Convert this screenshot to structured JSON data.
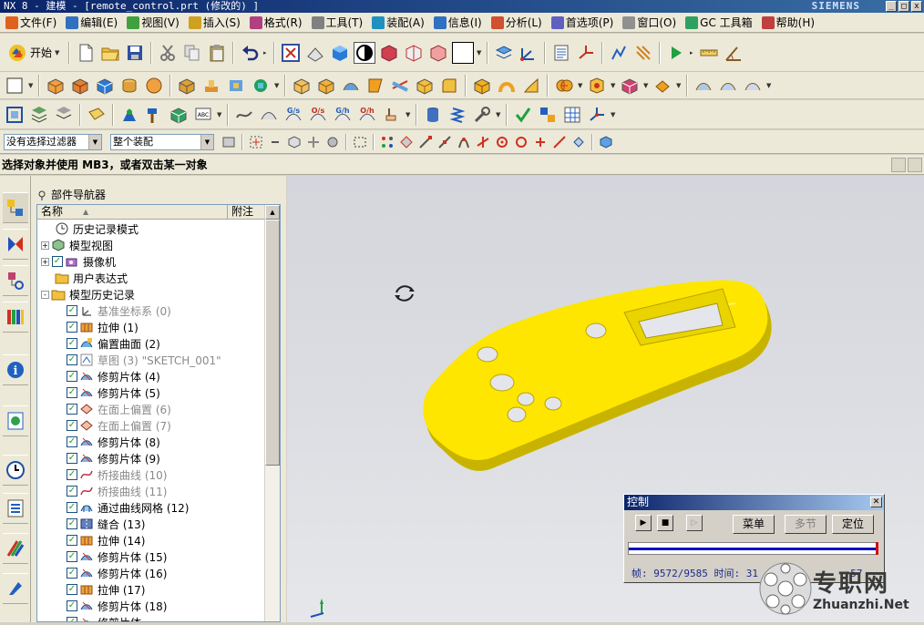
{
  "window": {
    "title": "NX 8 - 建模 - [remote_control.prt (修改的) ]",
    "brand": "SIEMENS",
    "controls": [
      "_",
      "□",
      "x"
    ]
  },
  "menu": {
    "items": [
      "文件(F)",
      "编辑(E)",
      "视图(V)",
      "插入(S)",
      "格式(R)",
      "工具(T)",
      "装配(A)",
      "信息(I)",
      "分析(L)",
      "首选项(P)",
      "窗口(O)",
      "GC 工具箱",
      "帮助(H)"
    ]
  },
  "toolbar": {
    "start_label": "开始"
  },
  "selection": {
    "filter_value": "没有选择过滤器",
    "scope_value": "整个装配"
  },
  "status": {
    "prompt": "选择对象并使用 MB3，或者双击某一对象"
  },
  "navigator": {
    "title": "部件导航器",
    "col_name": "名称",
    "col_attach": "附注",
    "nodes": [
      {
        "label": "历史记录模式",
        "icon": "clock-icon",
        "check": false,
        "dim": false,
        "expander": "",
        "indent": 1
      },
      {
        "label": "模型视图",
        "icon": "model-view-icon",
        "check": false,
        "dim": false,
        "expander": "+",
        "indent": 0
      },
      {
        "label": "摄像机",
        "icon": "camera-icon",
        "check": true,
        "dim": false,
        "expander": "+",
        "indent": 0
      },
      {
        "label": "用户表达式",
        "icon": "folder-icon",
        "check": false,
        "dim": false,
        "expander": "",
        "indent": 1
      },
      {
        "label": "模型历史记录",
        "icon": "folder-icon",
        "check": false,
        "dim": false,
        "expander": "-",
        "indent": 0
      },
      {
        "label": "基准坐标系 (0)",
        "icon": "datum-csys-icon",
        "check": true,
        "dim": true,
        "expander": "",
        "indent": 2
      },
      {
        "label": "拉伸 (1)",
        "icon": "extrude-icon",
        "check": true,
        "dim": false,
        "expander": "",
        "indent": 2
      },
      {
        "label": "偏置曲面 (2)",
        "icon": "offset-surface-icon",
        "check": true,
        "dim": false,
        "expander": "",
        "indent": 2
      },
      {
        "label": "草图 (3) \"SKETCH_001\"",
        "icon": "sketch-icon",
        "check": true,
        "dim": true,
        "expander": "",
        "indent": 2
      },
      {
        "label": "修剪片体 (4)",
        "icon": "trim-sheet-icon",
        "check": true,
        "dim": false,
        "expander": "",
        "indent": 2
      },
      {
        "label": "修剪片体 (5)",
        "icon": "trim-sheet-icon",
        "check": true,
        "dim": false,
        "expander": "",
        "indent": 2
      },
      {
        "label": "在面上偏置 (6)",
        "icon": "offset-on-face-icon",
        "check": true,
        "dim": true,
        "expander": "",
        "indent": 2
      },
      {
        "label": "在面上偏置 (7)",
        "icon": "offset-on-face-icon",
        "check": true,
        "dim": true,
        "expander": "",
        "indent": 2
      },
      {
        "label": "修剪片体 (8)",
        "icon": "trim-sheet-icon",
        "check": true,
        "dim": false,
        "expander": "",
        "indent": 2
      },
      {
        "label": "修剪片体 (9)",
        "icon": "trim-sheet-icon",
        "check": true,
        "dim": false,
        "expander": "",
        "indent": 2
      },
      {
        "label": "桥接曲线 (10)",
        "icon": "bridge-curve-icon",
        "check": true,
        "dim": true,
        "expander": "",
        "indent": 2
      },
      {
        "label": "桥接曲线 (11)",
        "icon": "bridge-curve-icon",
        "check": true,
        "dim": true,
        "expander": "",
        "indent": 2
      },
      {
        "label": "通过曲线网格 (12)",
        "icon": "curve-mesh-icon",
        "check": true,
        "dim": false,
        "expander": "",
        "indent": 2
      },
      {
        "label": "缝合 (13)",
        "icon": "sew-icon",
        "check": true,
        "dim": false,
        "expander": "",
        "indent": 2
      },
      {
        "label": "拉伸 (14)",
        "icon": "extrude-icon",
        "check": true,
        "dim": false,
        "expander": "",
        "indent": 2
      },
      {
        "label": "修剪片体 (15)",
        "icon": "trim-sheet-icon",
        "check": true,
        "dim": false,
        "expander": "",
        "indent": 2
      },
      {
        "label": "修剪片体 (16)",
        "icon": "trim-sheet-icon",
        "check": true,
        "dim": false,
        "expander": "",
        "indent": 2
      },
      {
        "label": "拉伸 (17)",
        "icon": "extrude-icon",
        "check": true,
        "dim": false,
        "expander": "",
        "indent": 2
      },
      {
        "label": "修剪片体 (18)",
        "icon": "trim-sheet-icon",
        "check": true,
        "dim": false,
        "expander": "",
        "indent": 2
      },
      {
        "label": "修剪片体",
        "icon": "trim-sheet-icon",
        "check": true,
        "dim": false,
        "expander": "",
        "indent": 2
      }
    ]
  },
  "control_dialog": {
    "title": "控制",
    "menu_label": "菜单",
    "multi_label": "多节",
    "locate_label": "定位",
    "frame_text": "帧: 9572/9585 时间: 31",
    "time_suffix": ":57",
    "progress": 0.9986
  },
  "watermark": {
    "cn": "专职网",
    "en": "Zhuanzhi.Net"
  },
  "colors": {
    "model": "#ffe600",
    "model_shade": "#c8b400",
    "title_bar": "#0a246a",
    "progress_bar": "#1010c0"
  }
}
